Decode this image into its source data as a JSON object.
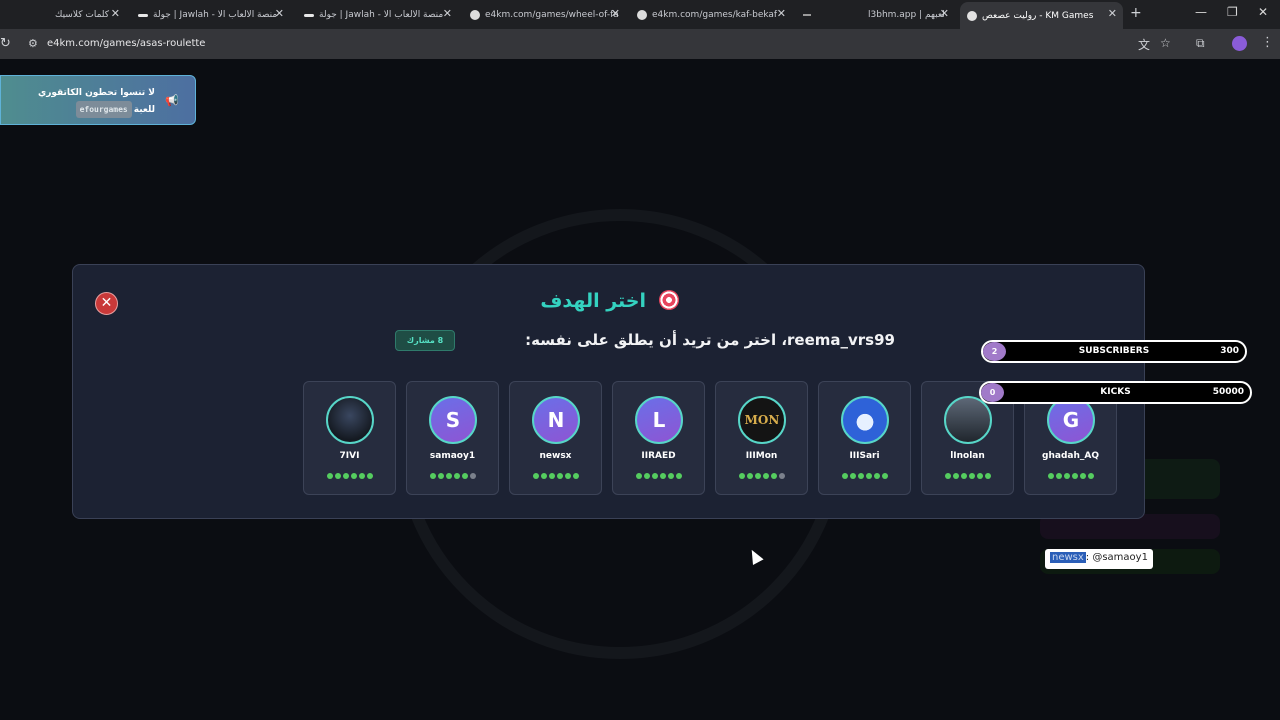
{
  "browser": {
    "tabs": [
      {
        "title": "كلمات كلاسيك",
        "active": false
      },
      {
        "title": "جولة | Jawlah - منصة الألعاب الا",
        "active": false
      },
      {
        "title": "جولة | Jawlah - منصة الألعاب الا",
        "active": false
      },
      {
        "title": "e4km.com/games/wheel-of-fa",
        "active": false
      },
      {
        "title": "e4km.com/games/kaf-bekaf",
        "active": false
      },
      {
        "title": "",
        "active": false
      },
      {
        "title": "l3bhm.app | لعبهم",
        "active": false
      },
      {
        "title": "روليت عصعص - KM Games",
        "active": true
      }
    ],
    "url": "e4km.com/games/asas-roulette"
  },
  "promo": {
    "line1": "لا تنسوا تحطون الكاتقوري",
    "tag": "efourgames",
    "line2": "للعبة"
  },
  "modal": {
    "title": "اختر الهدف",
    "subtitle": "reema_vrs99، اختر من تريد أن يطلق على نفسه:",
    "participants_badge": "8 مشارك",
    "players": [
      {
        "name": "7IVI",
        "avatar": "",
        "style": "img-dark",
        "dots": [
          1,
          1,
          1,
          1,
          1,
          1
        ]
      },
      {
        "name": "samaoy1",
        "avatar": "S",
        "style": "",
        "dots": [
          1,
          1,
          1,
          1,
          1,
          0
        ]
      },
      {
        "name": "newsx",
        "avatar": "N",
        "style": "",
        "dots": [
          1,
          1,
          1,
          1,
          1,
          1
        ]
      },
      {
        "name": "IIRAED",
        "avatar": "L",
        "style": "",
        "dots": [
          1,
          1,
          1,
          1,
          1,
          1
        ]
      },
      {
        "name": "IIIMon",
        "avatar": "MON",
        "style": "img-gold",
        "dots": [
          1,
          1,
          1,
          1,
          1,
          0
        ]
      },
      {
        "name": "IIISari",
        "avatar": "",
        "style": "img-blue",
        "dots": [
          1,
          1,
          1,
          1,
          1,
          1
        ]
      },
      {
        "name": "lInolan",
        "avatar": "",
        "style": "img-person",
        "dots": [
          1,
          1,
          1,
          1,
          1,
          1
        ]
      },
      {
        "name": "ghadah_AQ",
        "avatar": "G",
        "style": "",
        "dots": [
          1,
          1,
          1,
          1,
          1,
          1
        ]
      }
    ]
  },
  "stats": {
    "subscribers": {
      "count": "2",
      "label": "SUBSCRIBERS",
      "goal": "300"
    },
    "kicks": {
      "count": "0",
      "label": "KICKS",
      "goal": "50000"
    }
  },
  "chat": {
    "user": "newsx",
    "text": ": @samaoy1"
  }
}
